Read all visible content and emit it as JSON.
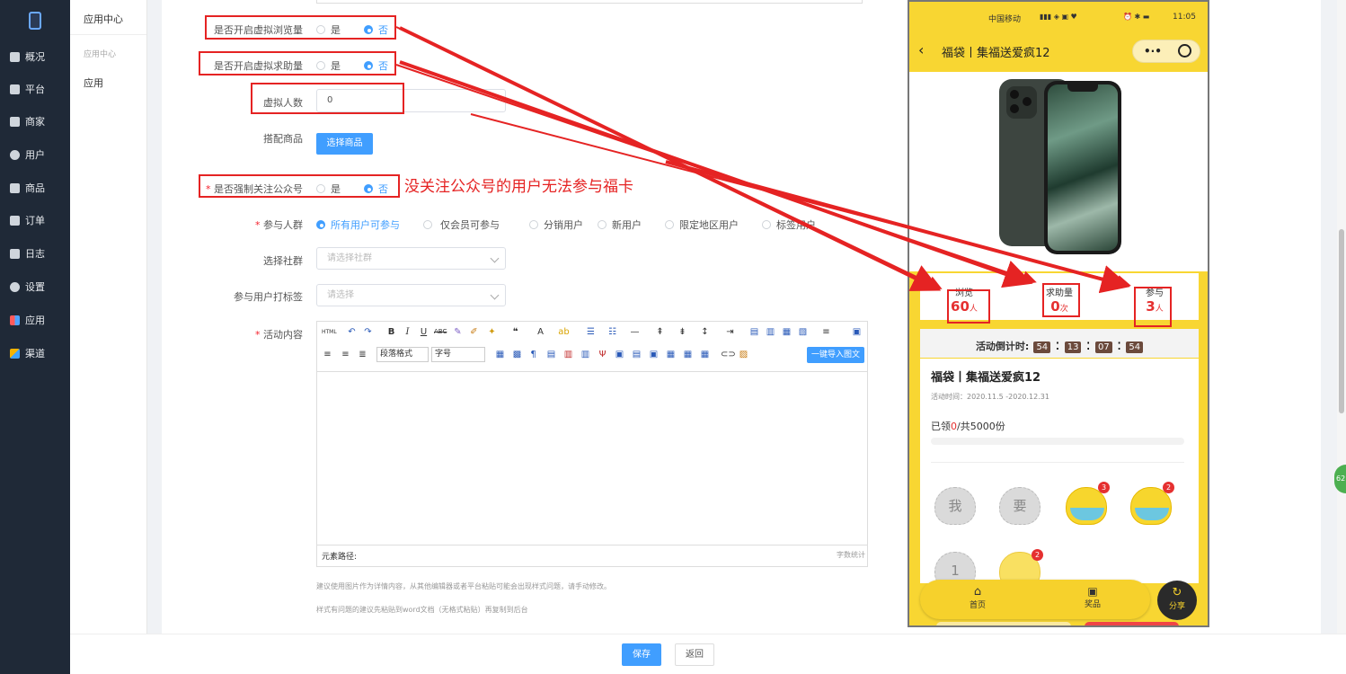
{
  "sidebar": {
    "items": [
      {
        "label": "概况",
        "icon": "overview-icon"
      },
      {
        "label": "平台",
        "icon": "platform-icon"
      },
      {
        "label": "商家",
        "icon": "merchant-icon"
      },
      {
        "label": "用户",
        "icon": "user-icon"
      },
      {
        "label": "商品",
        "icon": "goods-icon"
      },
      {
        "label": "订单",
        "icon": "order-icon"
      },
      {
        "label": "日志",
        "icon": "log-icon"
      },
      {
        "label": "设置",
        "icon": "settings-icon"
      },
      {
        "label": "应用",
        "icon": "apps-icon"
      },
      {
        "label": "渠道",
        "icon": "channel-icon"
      }
    ]
  },
  "subnav": {
    "title": "应用中心",
    "group": "应用中心",
    "item": "应用"
  },
  "form": {
    "virtual_views": {
      "label": "是否开启虚拟浏览量",
      "yes": "是",
      "no": "否",
      "selected": "否"
    },
    "virtual_help": {
      "label": "是否开启虚拟求助量",
      "yes": "是",
      "no": "否",
      "selected": "否"
    },
    "virtual_count": {
      "label": "虚拟人数",
      "value": "0"
    },
    "goods": {
      "label": "搭配商品",
      "button": "选择商品"
    },
    "force_follow": {
      "label": "是否强制关注公众号",
      "yes": "是",
      "no": "否",
      "selected": "否"
    },
    "participants": {
      "label": "参与人群",
      "options": [
        "所有用户可参与",
        "仅会员可参与",
        "分销用户",
        "新用户",
        "限定地区用户",
        "标签用户"
      ],
      "selected": "所有用户可参与"
    },
    "community": {
      "label": "选择社群",
      "placeholder": "请选择社群"
    },
    "tag": {
      "label": "参与用户打标签",
      "placeholder": "请选择"
    },
    "content": {
      "label": "活动内容",
      "paragraph_select": "段落格式",
      "size_select": "字号",
      "import_button": "一键导入图文",
      "path_label": "元素路径:",
      "word_count": "字数统计"
    },
    "hint1": "建议使用图片作为详情内容，从其他编辑器或者平台粘贴可能会出现样式问题，请手动修改。",
    "hint2": "样式有问题的建议先粘贴到word文档（无格式粘贴）再复制到后台"
  },
  "annotation": "没关注公众号的用户无法参与福卡",
  "footer": {
    "save": "保存",
    "back": "返回"
  },
  "phone": {
    "carrier": "中国移动",
    "time": "11:05",
    "title": "福袋丨集福送爱疯12",
    "stats": [
      {
        "label": "浏览",
        "value": "60",
        "unit": "人"
      },
      {
        "label": "求助量",
        "value": "0",
        "unit": "次"
      },
      {
        "label": "参与",
        "value": "3",
        "unit": "人"
      }
    ],
    "countdown_label": "活动倒计时:",
    "countdown": [
      "54",
      "13",
      "07",
      "54"
    ],
    "card_title": "福袋丨集福送爱疯12",
    "activity_time": "活动时间：2020.11.5 -2020.12.31",
    "claimed_prefix": "已领",
    "claimed_value": "0",
    "claimed_suffix": "/共5000份",
    "bags": [
      {
        "char": "我",
        "badge": ""
      },
      {
        "char": "要",
        "badge": ""
      },
      {
        "char": "",
        "badge": "3"
      },
      {
        "char": "",
        "badge": "2"
      },
      {
        "char": "1",
        "badge": ""
      },
      {
        "char": "",
        "badge": "2"
      }
    ],
    "tabs": [
      "首页",
      "奖品"
    ],
    "share": "分享"
  },
  "floating_badge": "62"
}
